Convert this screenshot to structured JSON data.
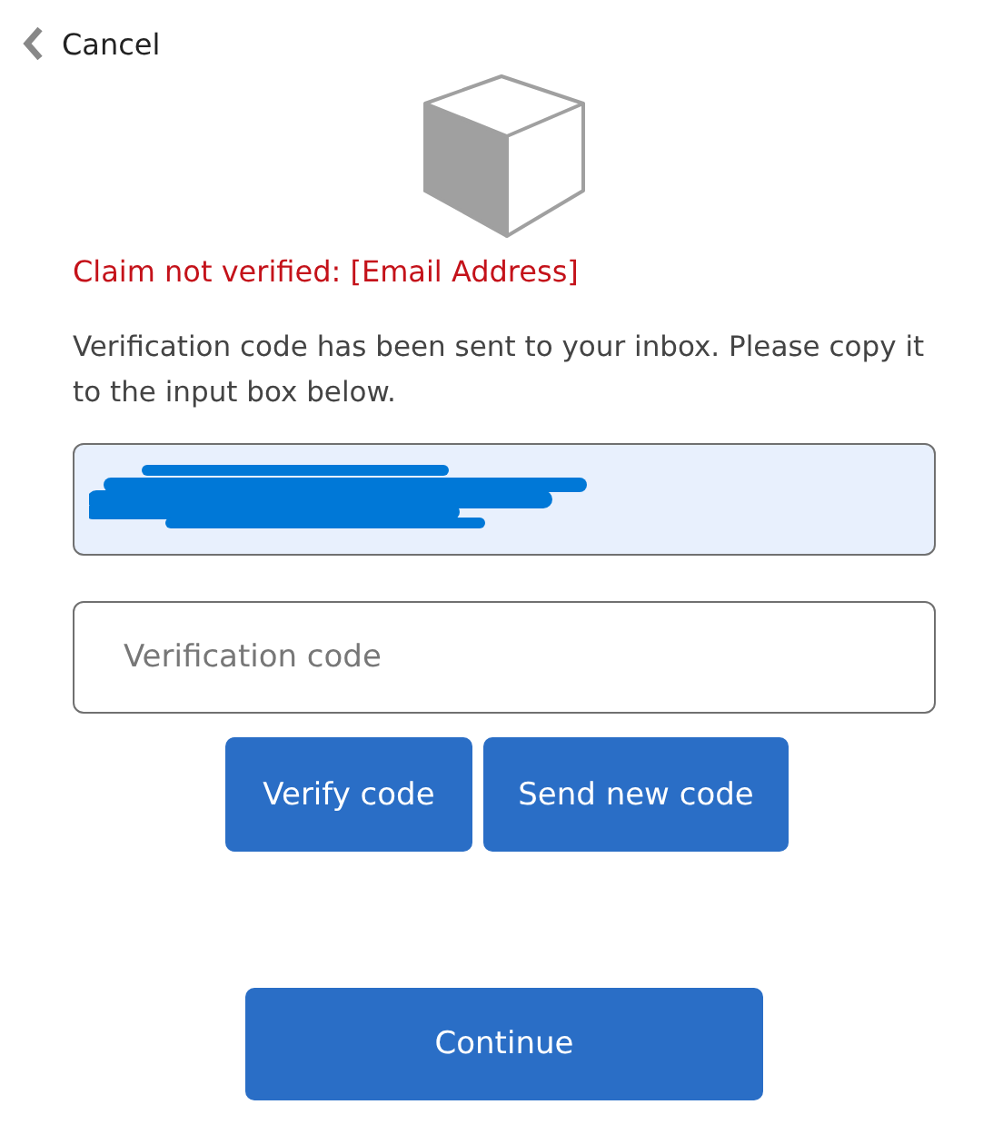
{
  "back_link": {
    "label": "Cancel"
  },
  "error": "Claim not verified: [Email Address]",
  "instructions": "Verification code has been sent to your inbox. Please copy it to the input box below.",
  "email_field": {
    "redacted": true,
    "disabled": true
  },
  "code_field": {
    "placeholder": "Verification code"
  },
  "code_buttons": [
    "Verify code",
    "Send new code"
  ],
  "continue_button": "Continue"
}
